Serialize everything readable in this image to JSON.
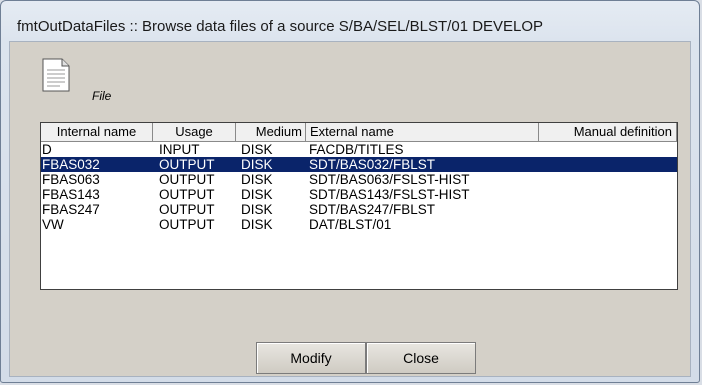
{
  "window": {
    "title": "fmtOutDataFiles :: Browse data files of a source S/BA/SEL/BLST/01 DEVELOP"
  },
  "toolbar": {
    "file_icon": "file-icon",
    "file_label": "File"
  },
  "table": {
    "columns": [
      "Internal name",
      "Usage",
      "Medium",
      "External name",
      "Manual definition"
    ],
    "rows": [
      {
        "internal_name": "D",
        "usage": "INPUT",
        "medium": "DISK",
        "external_name": "FACDB/TITLES",
        "manual_definition": ""
      },
      {
        "internal_name": "FBAS032",
        "usage": "OUTPUT",
        "medium": "DISK",
        "external_name": "SDT/BAS032/FBLST",
        "manual_definition": "",
        "selected": true
      },
      {
        "internal_name": "FBAS063",
        "usage": "OUTPUT",
        "medium": "DISK",
        "external_name": "SDT/BAS063/FSLST-HIST",
        "manual_definition": ""
      },
      {
        "internal_name": "FBAS143",
        "usage": "OUTPUT",
        "medium": "DISK",
        "external_name": "SDT/BAS143/FSLST-HIST",
        "manual_definition": ""
      },
      {
        "internal_name": "FBAS247",
        "usage": "OUTPUT",
        "medium": "DISK",
        "external_name": "SDT/BAS247/FBLST",
        "manual_definition": ""
      },
      {
        "internal_name": "VW",
        "usage": "OUTPUT",
        "medium": "DISK",
        "external_name": "DAT/BLST/01",
        "manual_definition": ""
      }
    ]
  },
  "buttons": {
    "modify_label": "Modify",
    "close_label": "Close"
  },
  "colors": {
    "selection": "#0a246a",
    "dialog_face": "#d4d0c8"
  }
}
